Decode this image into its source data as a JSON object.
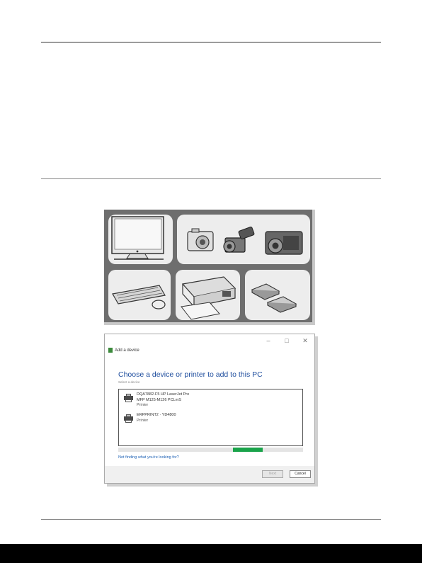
{
  "dialog": {
    "window_controls": [
      "–",
      "□",
      "✕"
    ],
    "title": "Add a device",
    "heading": "Choose a device or printer to add to this PC",
    "subheading": "Select a device",
    "devices": [
      {
        "line1": "DQA7882-F5   HP LaserJet Pro",
        "line2": "MFP M125-M126 PCLmS",
        "type": "Printer"
      },
      {
        "line1": "ERPPRINT2 · YD4800",
        "line2": "",
        "type": "Printer"
      }
    ],
    "progress": 0.15,
    "help_link": "Not finding what you're looking for?",
    "next_label": "Next",
    "cancel_label": "Cancel"
  }
}
